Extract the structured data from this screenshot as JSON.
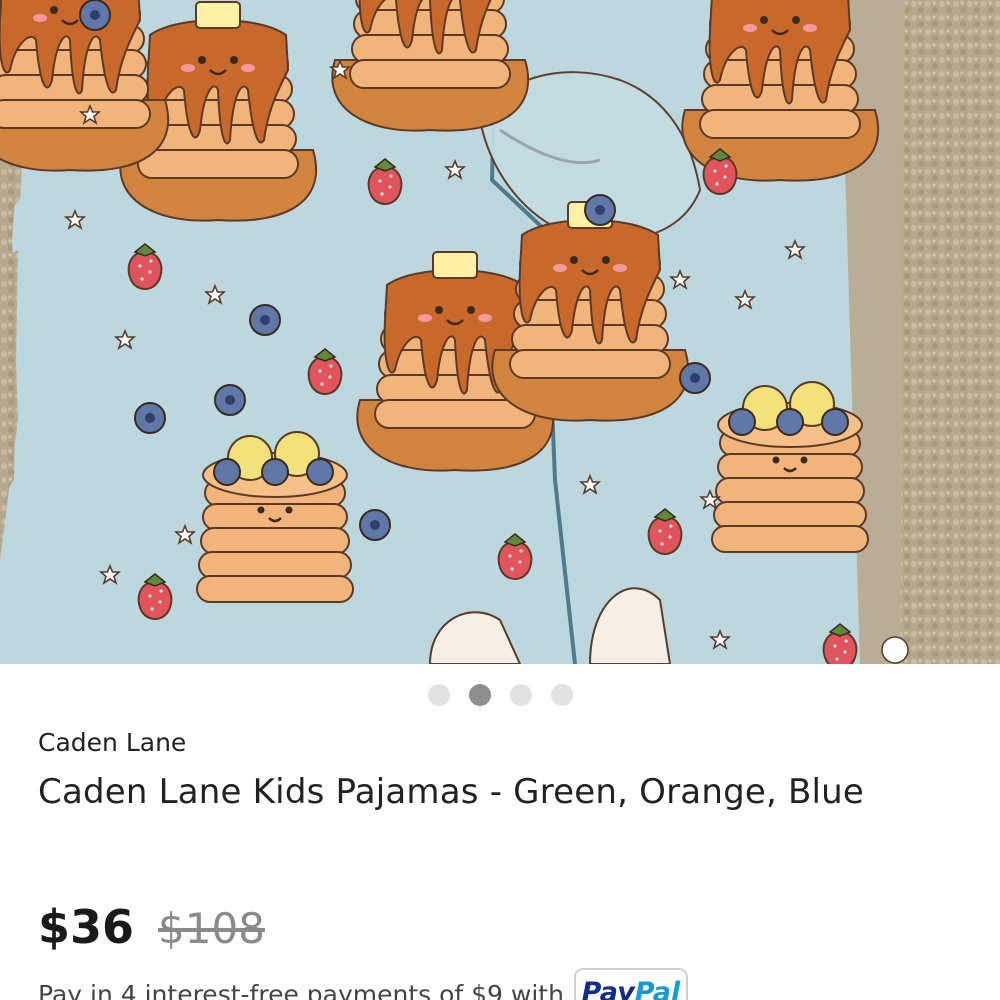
{
  "gallery": {
    "image_alt": "Caden Lane pancake print pajamas",
    "dots": [
      false,
      true,
      false,
      false
    ],
    "active_index": 1
  },
  "product": {
    "brand": "Caden Lane",
    "title": "Caden Lane Kids Pajamas - Green, Orange, Blue",
    "price": "$36",
    "original_price": "$108"
  },
  "payment": {
    "installment_text": "Pay in 4 interest-free payments of $9 with",
    "badge_pay": "Pay",
    "badge_pal": "Pal"
  },
  "colors": {
    "fabric": "#bcd7dd",
    "carpet": "#b8a88e",
    "pancake": "#e9a063",
    "syrup": "#c8692b",
    "strawberry": "#e2545c",
    "blueberry": "#5f78a8",
    "paypal_dark": "#142c8e",
    "paypal_light": "#179bd7"
  }
}
